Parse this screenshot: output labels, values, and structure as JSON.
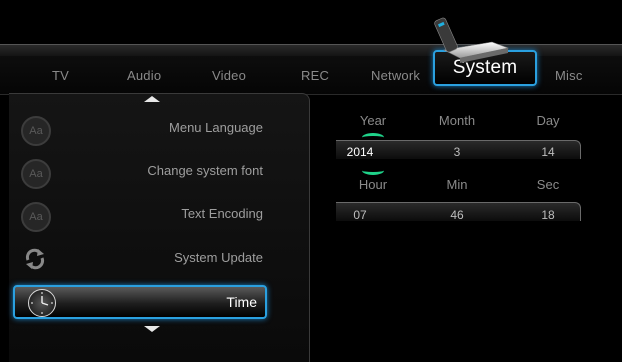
{
  "tabs": [
    {
      "label": "TV"
    },
    {
      "label": "Audio"
    },
    {
      "label": "Video"
    },
    {
      "label": "REC"
    },
    {
      "label": "Network"
    },
    {
      "label": "System",
      "active": true
    },
    {
      "label": "Misc"
    }
  ],
  "menu": {
    "items": [
      {
        "label": "Menu Language",
        "icon": "font-icon"
      },
      {
        "label": "Change system font",
        "icon": "font-icon"
      },
      {
        "label": "Text Encoding",
        "icon": "font-icon"
      },
      {
        "label": "System Update",
        "icon": "refresh-icon"
      },
      {
        "label": "Time",
        "icon": "clock-icon",
        "selected": true
      }
    ],
    "font_icon_text": "Aa"
  },
  "datetime": {
    "headers": {
      "year": "Year",
      "month": "Month",
      "day": "Day",
      "hour": "Hour",
      "min": "Min",
      "sec": "Sec"
    },
    "values": {
      "year": "2014",
      "month": "3",
      "day": "14",
      "hour": "07",
      "min": "46",
      "sec": "18"
    },
    "focused_field": "year"
  },
  "colors": {
    "accent": "#2aa0e0",
    "focus_indicator": "#1fd38a",
    "background": "#000000"
  }
}
